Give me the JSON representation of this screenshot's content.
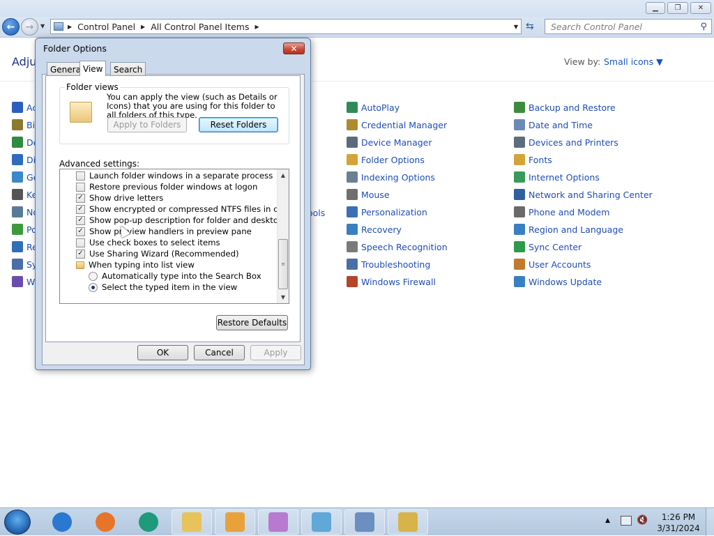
{
  "window": {
    "address": [
      "Control Panel",
      "All Control Panel Items"
    ],
    "search_placeholder": "Search Control Panel",
    "heading": "Adju",
    "view_by_label": "View by:",
    "view_by_value": "Small icons ▼"
  },
  "left_column": [
    {
      "label": "Ac",
      "icon": "flag-icon",
      "color": "#2a5fbf"
    },
    {
      "label": "Bit",
      "icon": "drive-lock-icon",
      "color": "#8d7a2e"
    },
    {
      "label": "De",
      "icon": "chrome-icon",
      "color": "#2e8b3f"
    },
    {
      "label": "Dis",
      "icon": "monitor-icon",
      "color": "#2d6cc0"
    },
    {
      "label": "Ge",
      "icon": "globe-icon",
      "color": "#3a8ac9"
    },
    {
      "label": "Ke",
      "icon": "keyboard-icon",
      "color": "#555555"
    },
    {
      "label": "No",
      "icon": "notification-icon",
      "color": "#5a7a9a"
    },
    {
      "label": "Po",
      "icon": "power-icon",
      "color": "#3c9a3c"
    },
    {
      "label": "Re",
      "icon": "network-icon",
      "color": "#2f6fb5"
    },
    {
      "label": "Sy",
      "icon": "system-icon",
      "color": "#4a6ea8"
    },
    {
      "label": "Wi",
      "icon": "windows-icon",
      "color": "#6a4cb0"
    }
  ],
  "partial_label": "ools",
  "middle_column": [
    {
      "label": "AutoPlay",
      "icon": "autoplay-icon",
      "color": "#2e8b57"
    },
    {
      "label": "Credential Manager",
      "icon": "credential-icon",
      "color": "#b08a2e"
    },
    {
      "label": "Device Manager",
      "icon": "device-manager-icon",
      "color": "#5a6b7d"
    },
    {
      "label": "Folder Options",
      "icon": "folder-options-icon",
      "color": "#d4a43a"
    },
    {
      "label": "Indexing Options",
      "icon": "indexing-icon",
      "color": "#6b7f95"
    },
    {
      "label": "Mouse",
      "icon": "mouse-icon",
      "color": "#6f6f6f"
    },
    {
      "label": "Personalization",
      "icon": "personalization-icon",
      "color": "#3b6fb5"
    },
    {
      "label": "Recovery",
      "icon": "recovery-icon",
      "color": "#3a7fc1"
    },
    {
      "label": "Speech Recognition",
      "icon": "microphone-icon",
      "color": "#7a7a7a"
    },
    {
      "label": "Troubleshooting",
      "icon": "troubleshooting-icon",
      "color": "#4a6fa5"
    },
    {
      "label": "Windows Firewall",
      "icon": "firewall-icon",
      "color": "#b5452a"
    }
  ],
  "right_column": [
    {
      "label": "Backup and Restore",
      "icon": "backup-icon",
      "color": "#3d8b3d"
    },
    {
      "label": "Date and Time",
      "icon": "clock-icon",
      "color": "#6a8bb5"
    },
    {
      "label": "Devices and Printers",
      "icon": "printer-icon",
      "color": "#5d6d7e"
    },
    {
      "label": "Fonts",
      "icon": "fonts-icon",
      "color": "#d4a43a"
    },
    {
      "label": "Internet Options",
      "icon": "internet-icon",
      "color": "#3a9a5a"
    },
    {
      "label": "Network and Sharing Center",
      "icon": "network-sharing-icon",
      "color": "#2f5f9f"
    },
    {
      "label": "Phone and Modem",
      "icon": "phone-icon",
      "color": "#6a6a6a"
    },
    {
      "label": "Region and Language",
      "icon": "region-icon",
      "color": "#3a7fc1"
    },
    {
      "label": "Sync Center",
      "icon": "sync-icon",
      "color": "#2e9a4a"
    },
    {
      "label": "User Accounts",
      "icon": "user-accounts-icon",
      "color": "#c07a2e"
    },
    {
      "label": "Windows Update",
      "icon": "windows-update-icon",
      "color": "#3a7fc1"
    }
  ],
  "dialog": {
    "title": "Folder Options",
    "tabs": [
      "General",
      "View",
      "Search"
    ],
    "folder_views": {
      "legend": "Folder views",
      "description": "You can apply the view (such as Details or Icons) that you are using for this folder to all folders of this type.",
      "apply_button": "Apply to Folders",
      "reset_button": "Reset Folders"
    },
    "advanced_label": "Advanced settings:",
    "settings": [
      {
        "type": "check",
        "checked": false,
        "label": "Launch folder windows in a separate process",
        "indent": 1
      },
      {
        "type": "check",
        "checked": false,
        "label": "Restore previous folder windows at logon",
        "indent": 1
      },
      {
        "type": "check",
        "checked": true,
        "label": "Show drive letters",
        "indent": 1
      },
      {
        "type": "check",
        "checked": true,
        "label": "Show encrypted or compressed NTFS files in color",
        "indent": 1
      },
      {
        "type": "check",
        "checked": true,
        "label": "Show pop-up description for folder and desktop items",
        "indent": 1
      },
      {
        "type": "check",
        "checked": true,
        "label": "Show preview handlers in preview pane",
        "indent": 1
      },
      {
        "type": "check",
        "checked": false,
        "label": "Use check boxes to select items",
        "indent": 1
      },
      {
        "type": "check",
        "checked": true,
        "label": "Use Sharing Wizard (Recommended)",
        "indent": 1
      },
      {
        "type": "folder",
        "label": "When typing into list view",
        "indent": 1
      },
      {
        "type": "radio",
        "checked": false,
        "label": "Automatically type into the Search Box",
        "indent": 2
      },
      {
        "type": "radio",
        "checked": true,
        "label": "Select the typed item in the view",
        "indent": 2
      }
    ],
    "restore_defaults": "Restore Defaults",
    "ok": "OK",
    "cancel": "Cancel",
    "apply": "Apply"
  },
  "taskbar": {
    "time": "1:26 PM",
    "date": "3/31/2024",
    "apps": [
      "internet-explorer-icon",
      "firefox-icon",
      "media-center-icon",
      "file-explorer-icon",
      "media-player-icon",
      "paint-icon",
      "notepad-icon",
      "control-panel-icon",
      "folder-options-task-icon"
    ]
  }
}
